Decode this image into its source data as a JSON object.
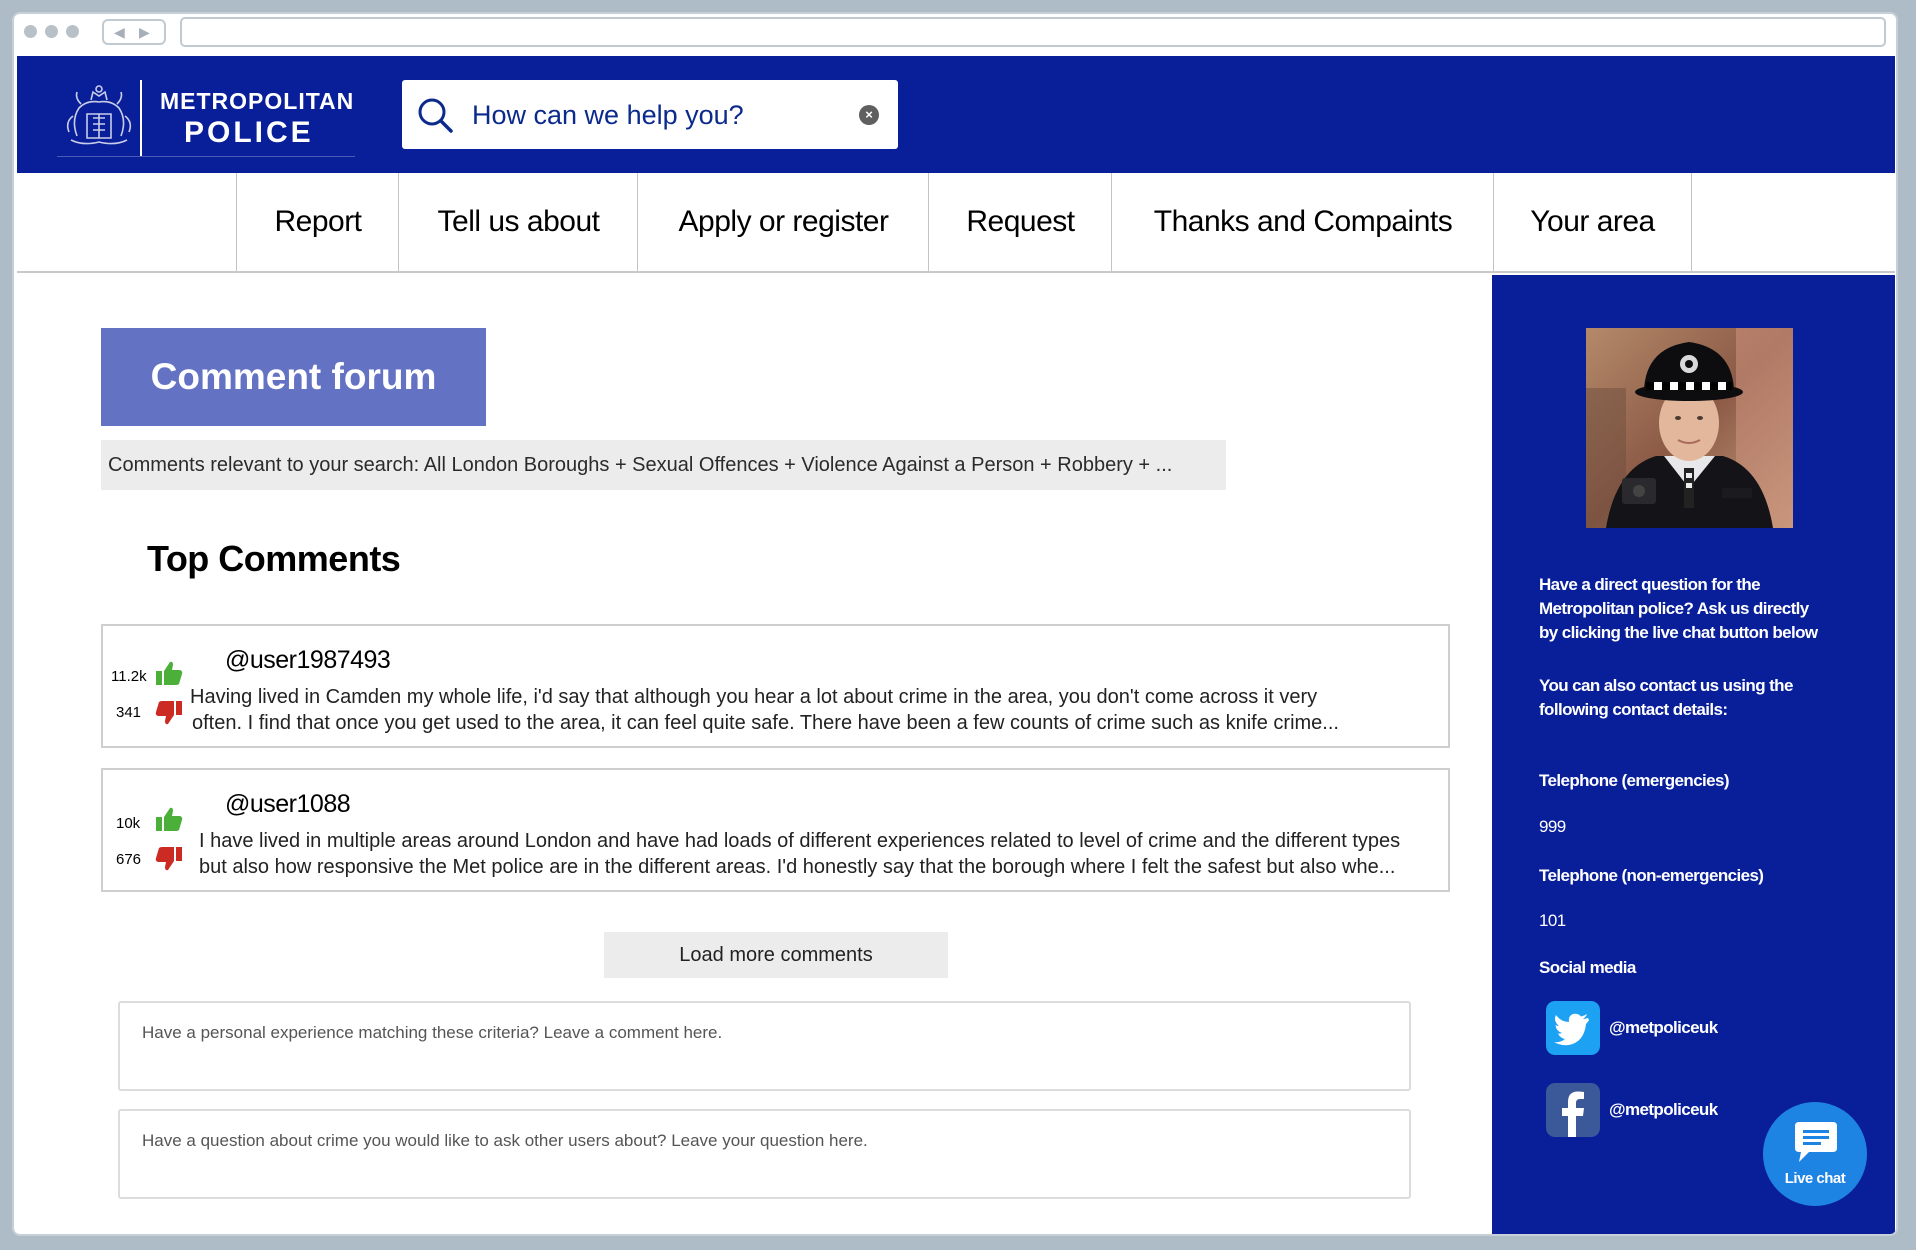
{
  "header": {
    "logo_line1": "METROPOLITAN",
    "logo_line2": "POLICE",
    "search_placeholder": "How can we help you?",
    "brand_color": "#091f9a"
  },
  "nav": {
    "tabs": [
      {
        "label": "Report"
      },
      {
        "label": "Tell us about"
      },
      {
        "label": "Apply or register"
      },
      {
        "label": "Request"
      },
      {
        "label": "Thanks and Compaints"
      },
      {
        "label": "Your area"
      }
    ]
  },
  "main": {
    "forum_title": "Comment forum",
    "search_summary": "Comments relevant to your search: All London Boroughs + Sexual Offences + Violence Against a Person + Robbery + ...",
    "top_comments_title": "Top Comments",
    "comments": [
      {
        "user": "@user1987493",
        "likes": "11.2k",
        "dislikes": "341",
        "text_line1": "Having lived in Camden my whole life, i'd say that although you hear a lot about crime in the area, you don't come across it very",
        "text_line2": "often. I find that once you get used to the area, it can feel quite safe. There have been a few counts of crime such as knife crime..."
      },
      {
        "user": "@user1088",
        "likes": "10k",
        "dislikes": "676",
        "text_line1": "I have lived in multiple areas around London and have had loads of different experiences related to level of crime and the different types",
        "text_line2": "but also how responsive the Met police are in the different areas. I'd honestly say that the borough where I felt the safest but also whe..."
      }
    ],
    "load_more_label": "Load more comments",
    "comment_placeholder": "Have a personal experience matching these criteria? Leave a comment here.",
    "question_placeholder": "Have a question about crime you would like to ask other users about? Leave your question here."
  },
  "sidebar": {
    "intro_line1": "Have a direct question for the",
    "intro_line2": "Metropolitan police? Ask us directly",
    "intro_line3": "by clicking the live chat button below",
    "contact_line1": "You can also contact us using the",
    "contact_line2": "following contact details:",
    "tel_emergency_label": "Telephone (emergencies)",
    "tel_emergency_value": "999",
    "tel_nonemergency_label": "Telephone (non-emergencies)",
    "tel_nonemergency_value": "101",
    "social_label": "Social media",
    "twitter_handle": "@metpoliceuk",
    "facebook_handle": "@metpoliceuk",
    "live_chat_label": "Live chat"
  },
  "icons": {
    "search": "search-icon",
    "clear": "clear-icon",
    "like": "thumbs-up-icon",
    "dislike": "thumbs-down-icon",
    "twitter": "twitter-icon",
    "facebook": "facebook-icon",
    "chat": "chat-bubble-icon"
  }
}
